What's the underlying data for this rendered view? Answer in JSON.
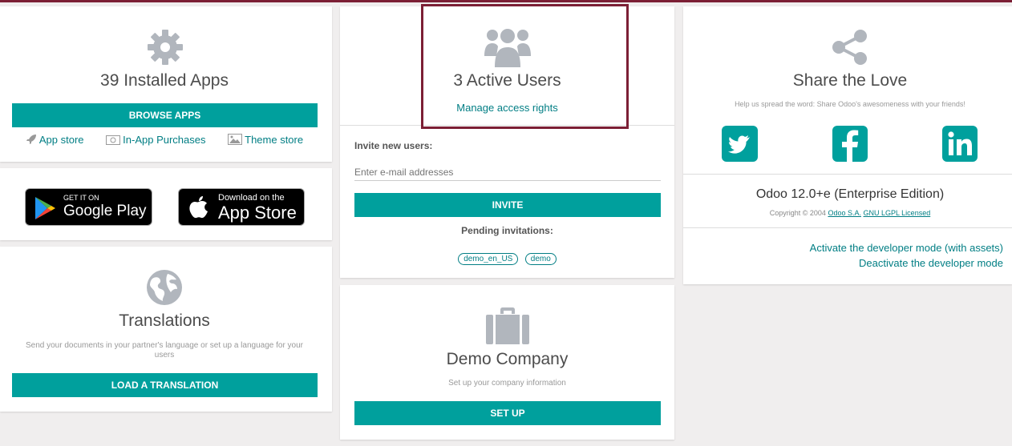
{
  "apps": {
    "title": "39 Installed Apps",
    "browse_label": "BROWSE APPS",
    "links": [
      "App store",
      "In-App Purchases",
      "Theme store"
    ]
  },
  "stores": {
    "google_small": "GET IT ON",
    "google_big": "Google Play",
    "apple_small": "Download on the",
    "apple_big": "App Store"
  },
  "translations": {
    "title": "Translations",
    "desc": "Send your documents in your partner's language or set up a language for your users",
    "load_label": "LOAD A TRANSLATION"
  },
  "users": {
    "title": "3 Active Users",
    "manage_link": "Manage access rights",
    "invite_heading": "Invite new users:",
    "email_placeholder": "Enter e-mail addresses",
    "invite_label": "INVITE",
    "pending_heading": "Pending invitations:",
    "pending": [
      "demo_en_US",
      "demo"
    ]
  },
  "company": {
    "title": "Demo Company",
    "desc": "Set up your company information",
    "setup_label": "SET UP"
  },
  "share": {
    "title": "Share the Love",
    "desc": "Help us spread the word: Share Odoo's awesomeness with your friends!",
    "version": "Odoo 12.0+e (Enterprise Edition)",
    "copyright_prefix": "Copyright © 2004 ",
    "copyright_company": "Odoo S.A.",
    "copyright_license": "GNU LGPL Licensed",
    "activate_dev": "Activate the developer mode (with assets)",
    "deactivate_dev": "Deactivate the developer mode"
  },
  "colors": {
    "accent": "#00a09d",
    "link": "#017e84",
    "highlight": "#7c1f35",
    "icon_grey": "#b1b6bd"
  }
}
